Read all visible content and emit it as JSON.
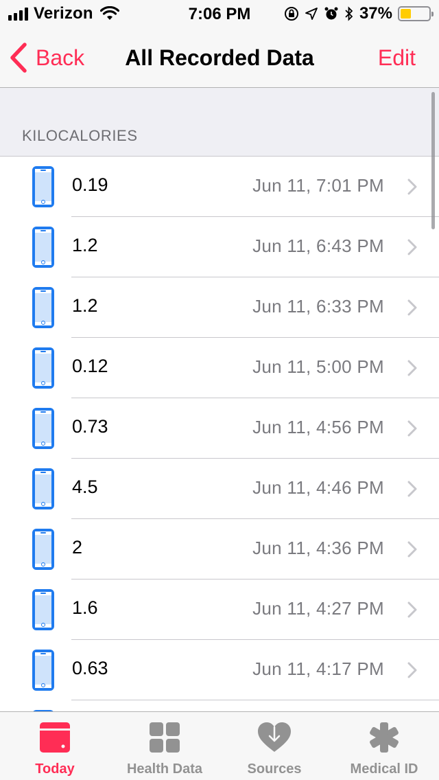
{
  "status_bar": {
    "carrier": "Verizon",
    "time": "7:06 PM",
    "battery_percent": "37%",
    "battery_level": 0.37,
    "battery_color": "#ffcc00"
  },
  "nav": {
    "back_label": "Back",
    "title": "All Recorded Data",
    "edit_label": "Edit",
    "accent_color": "#ff2d55"
  },
  "section": {
    "header": "KILOCALORIES"
  },
  "records": [
    {
      "value": "0.19",
      "date": "Jun 11, 7:01 PM",
      "source_icon": "iphone-icon"
    },
    {
      "value": "1.2",
      "date": "Jun 11, 6:43 PM",
      "source_icon": "iphone-icon"
    },
    {
      "value": "1.2",
      "date": "Jun 11, 6:33 PM",
      "source_icon": "iphone-icon"
    },
    {
      "value": "0.12",
      "date": "Jun 11, 5:00 PM",
      "source_icon": "iphone-icon"
    },
    {
      "value": "0.73",
      "date": "Jun 11, 4:56 PM",
      "source_icon": "iphone-icon"
    },
    {
      "value": "4.5",
      "date": "Jun 11, 4:46 PM",
      "source_icon": "iphone-icon"
    },
    {
      "value": "2",
      "date": "Jun 11, 4:36 PM",
      "source_icon": "iphone-icon"
    },
    {
      "value": "1.6",
      "date": "Jun 11, 4:27 PM",
      "source_icon": "iphone-icon"
    },
    {
      "value": "0.63",
      "date": "Jun 11, 4:17 PM",
      "source_icon": "iphone-icon"
    },
    {
      "value": "",
      "date": "",
      "source_icon": "iphone-icon"
    }
  ],
  "tab_bar": {
    "tabs": [
      {
        "label": "Today",
        "icon": "today-icon",
        "active": true
      },
      {
        "label": "Health Data",
        "icon": "health-data-grid-icon",
        "active": false
      },
      {
        "label": "Sources",
        "icon": "sources-heart-icon",
        "active": false
      },
      {
        "label": "Medical ID",
        "icon": "medical-id-asterisk-icon",
        "active": false
      }
    ]
  }
}
